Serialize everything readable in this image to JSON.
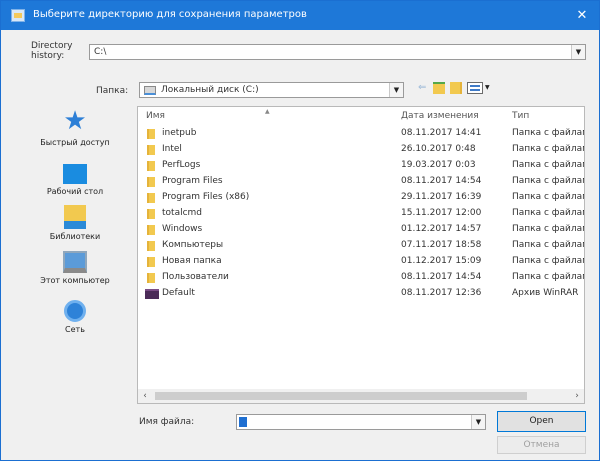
{
  "window": {
    "title": "Выберите директорию для сохранения параметров",
    "close_glyph": "✕"
  },
  "history": {
    "label": "Directory history:",
    "value": "C:\\"
  },
  "location": {
    "label": "Папка:",
    "value": "Локальный диск (C:)"
  },
  "sidebar": {
    "items": [
      {
        "label": "Быстрый доступ",
        "icon": "star-icon"
      },
      {
        "label": "Рабочий стол",
        "icon": "desktop-icon"
      },
      {
        "label": "Библиотеки",
        "icon": "libraries-icon"
      },
      {
        "label": "Этот компьютер",
        "icon": "computer-icon"
      },
      {
        "label": "Сеть",
        "icon": "network-icon"
      }
    ]
  },
  "files": {
    "columns": {
      "name": "Имя",
      "date": "Дата изменения",
      "type": "Тип"
    },
    "rows": [
      {
        "name": "inetpub",
        "date": "08.11.2017 14:41",
        "type": "Папка с файлами",
        "icon": "folder-icon"
      },
      {
        "name": "Intel",
        "date": "26.10.2017 0:48",
        "type": "Папка с файлами",
        "icon": "folder-icon"
      },
      {
        "name": "PerfLogs",
        "date": "19.03.2017 0:03",
        "type": "Папка с файлами",
        "icon": "folder-icon"
      },
      {
        "name": "Program Files",
        "date": "08.11.2017 14:54",
        "type": "Папка с файлами",
        "icon": "folder-icon"
      },
      {
        "name": "Program Files (x86)",
        "date": "29.11.2017 16:39",
        "type": "Папка с файлами",
        "icon": "folder-icon"
      },
      {
        "name": "totalcmd",
        "date": "15.11.2017 12:00",
        "type": "Папка с файлами",
        "icon": "folder-icon"
      },
      {
        "name": "Windows",
        "date": "01.12.2017 14:57",
        "type": "Папка с файлами",
        "icon": "folder-icon"
      },
      {
        "name": "Компьютеры",
        "date": "07.11.2017 18:58",
        "type": "Папка с файлами",
        "icon": "folder-icon"
      },
      {
        "name": "Новая папка",
        "date": "01.12.2017 15:09",
        "type": "Папка с файлами",
        "icon": "folder-icon"
      },
      {
        "name": "Пользователи",
        "date": "08.11.2017 14:54",
        "type": "Папка с файлами",
        "icon": "folder-icon"
      },
      {
        "name": "Default",
        "date": "08.11.2017 12:36",
        "type": "Архив WinRAR",
        "icon": "winrar-archive-icon"
      }
    ]
  },
  "filename": {
    "label": "Имя файла:",
    "value": ""
  },
  "buttons": {
    "open": "Open",
    "cancel": "Отмена"
  }
}
